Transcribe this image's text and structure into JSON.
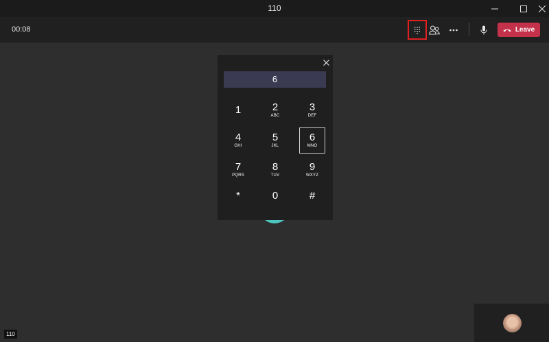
{
  "window": {
    "title": "110",
    "controls": [
      "minimize-icon",
      "maximize-icon",
      "close-icon"
    ]
  },
  "toolbar": {
    "timer": "00:08",
    "buttons": [
      "dialpad-icon",
      "people-icon",
      "more-icon",
      "microphone-icon"
    ],
    "leave_label": "Leave",
    "leave_color": "#c4314b",
    "highlight_color": "#e02020"
  },
  "dialpad": {
    "display_value": "6",
    "keys": [
      {
        "digit": "1",
        "letters": ""
      },
      {
        "digit": "2",
        "letters": "ABC"
      },
      {
        "digit": "3",
        "letters": "DEF"
      },
      {
        "digit": "4",
        "letters": "GHI"
      },
      {
        "digit": "5",
        "letters": "JKL"
      },
      {
        "digit": "6",
        "letters": "MNO",
        "active": true
      },
      {
        "digit": "7",
        "letters": "PQRS"
      },
      {
        "digit": "8",
        "letters": "TUV"
      },
      {
        "digit": "9",
        "letters": "WXYZ"
      },
      {
        "digit": "*",
        "letters": ""
      },
      {
        "digit": "0",
        "letters": ""
      },
      {
        "digit": "#",
        "letters": ""
      }
    ]
  },
  "remote": {
    "avatar_color": "#4ec6c0"
  },
  "badge": {
    "label": "110"
  }
}
